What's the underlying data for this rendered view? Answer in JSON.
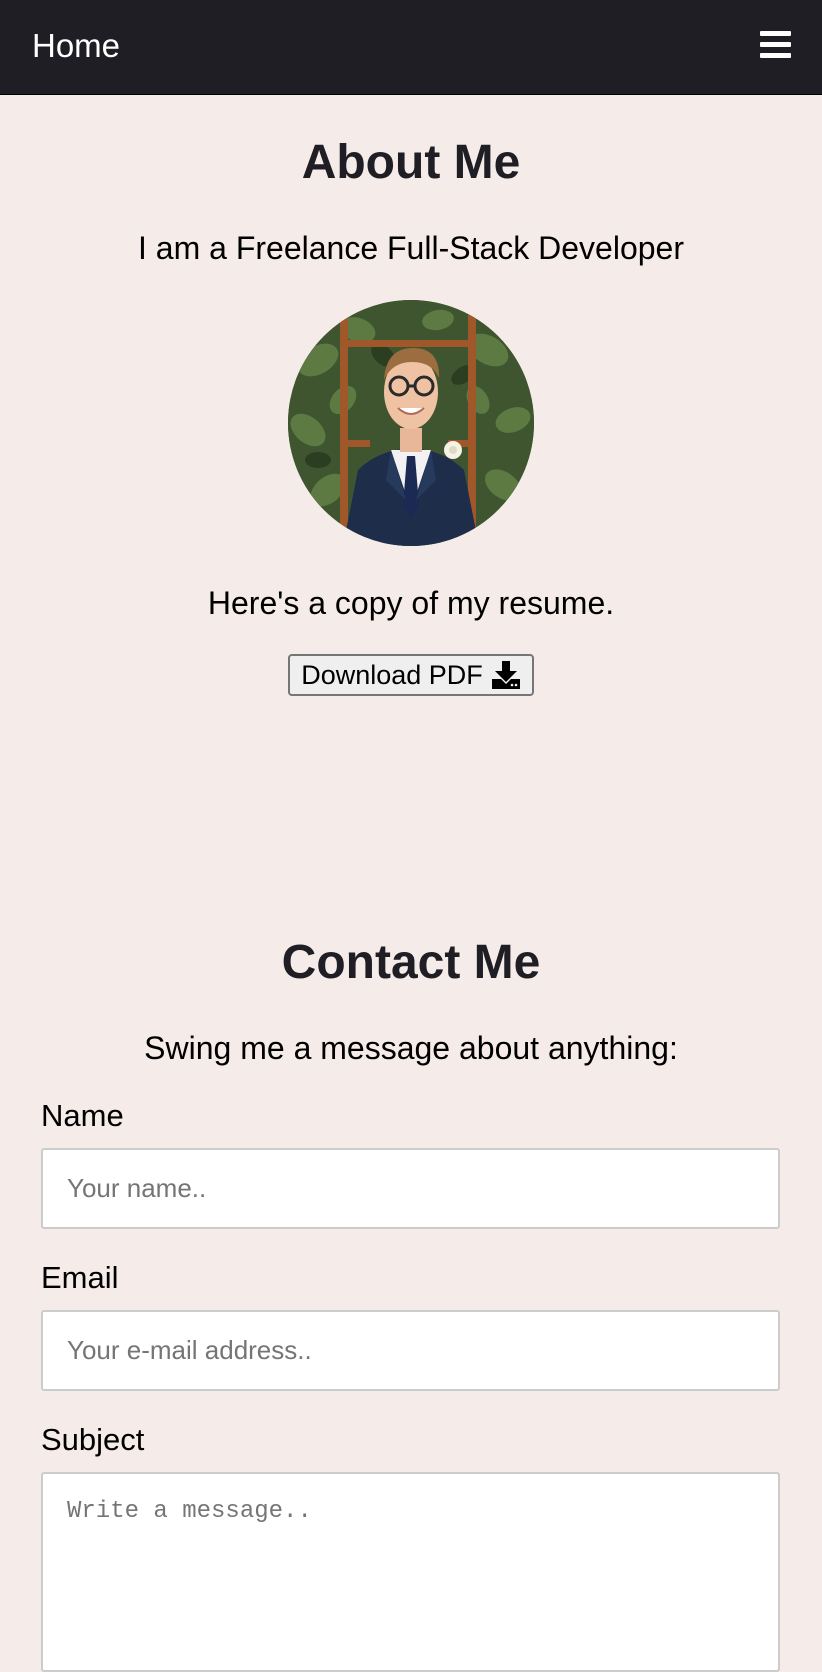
{
  "nav": {
    "home_label": "Home",
    "menu_icon": "hamburger-menu-icon"
  },
  "about": {
    "title": "About Me",
    "subtitle": "I am a Freelance Full-Stack Developer",
    "resume_text": "Here's a copy of my resume.",
    "download_label": "Download PDF",
    "download_icon": "download-icon"
  },
  "contact": {
    "title": "Contact Me",
    "subtitle": "Swing me a message about anything:",
    "name_label": "Name",
    "name_placeholder": "Your name..",
    "email_label": "Email",
    "email_placeholder": "Your e-mail address..",
    "subject_label": "Subject",
    "subject_placeholder": "Write a message.."
  },
  "colors": {
    "navbar_bg": "#1f1e24",
    "page_bg": "#f5ebe8",
    "heading": "#1f1e24"
  }
}
